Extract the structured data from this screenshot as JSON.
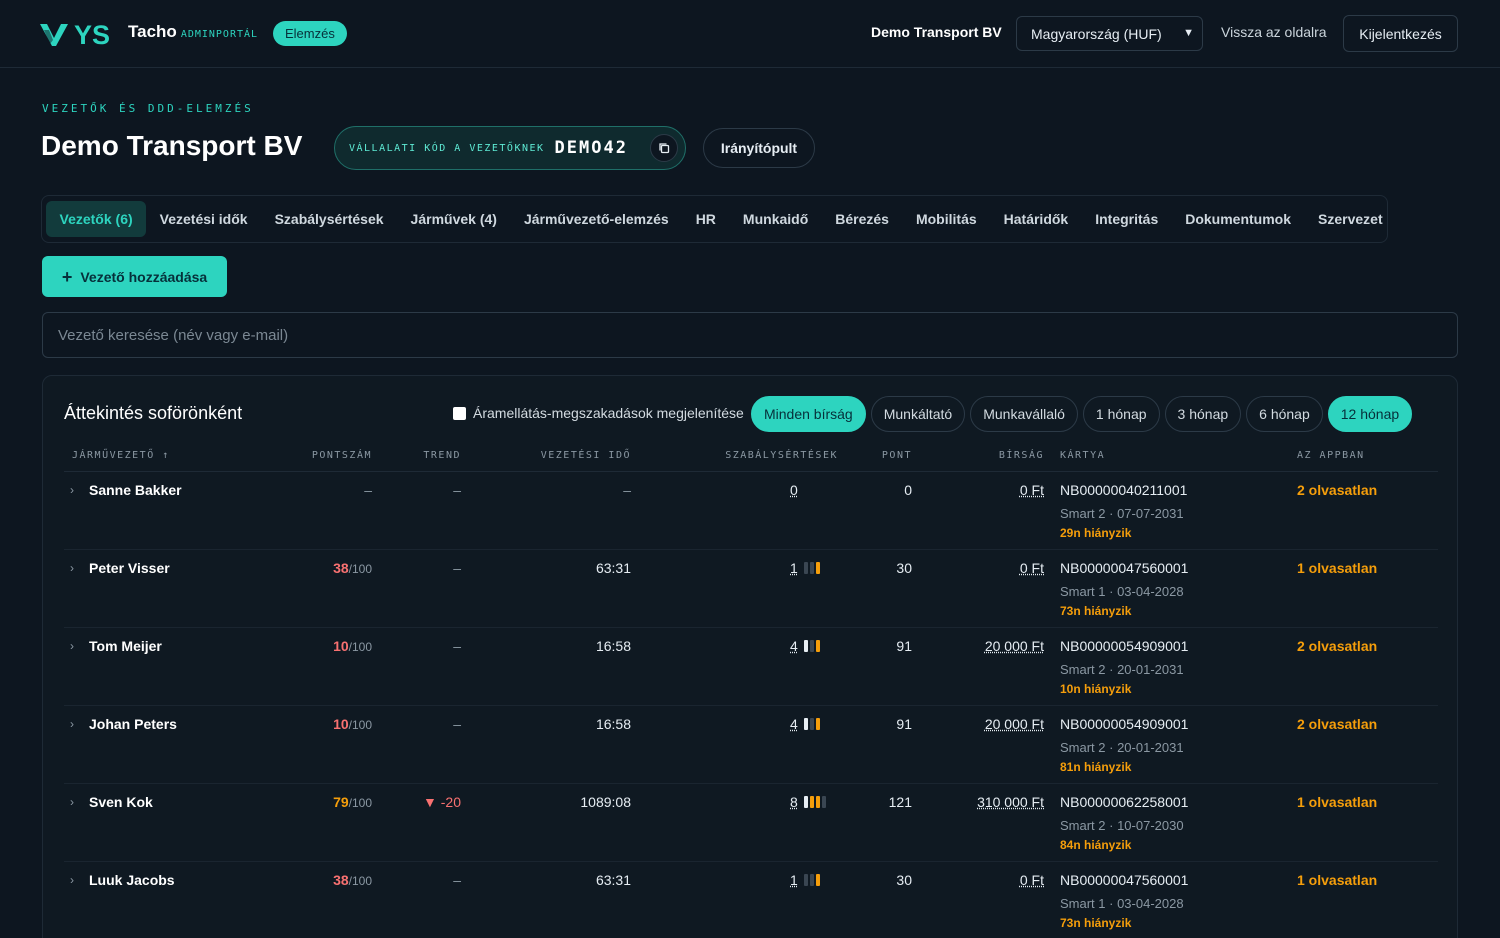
{
  "header": {
    "brand": "Tacho",
    "brand_sub": "ADMINPORTÁL",
    "badge": "Elemzés",
    "company": "Demo Transport BV",
    "country_select": "Magyarország (HUF)",
    "back_link": "Vissza az oldalra",
    "logout": "Kijelentkezés"
  },
  "page": {
    "eyebrow": "VEZETŐK ÉS DDD-ELEMZÉS",
    "title": "Demo Transport BV",
    "code_label": "VÁLLALATI KÓD A VEZETŐKNEK",
    "code_value": "DEMO42",
    "dashboard_button": "Irányítópult"
  },
  "tabs": [
    {
      "label": "Vezetők (6)",
      "active": true
    },
    {
      "label": "Vezetési idők"
    },
    {
      "label": "Szabálysértések"
    },
    {
      "label": "Járművek (4)"
    },
    {
      "label": "Járművezető-elemzés"
    },
    {
      "label": "HR"
    },
    {
      "label": "Munkaidő"
    },
    {
      "label": "Bérezés"
    },
    {
      "label": "Mobilitás"
    },
    {
      "label": "Határidők"
    },
    {
      "label": "Integritás"
    },
    {
      "label": "Dokumentumok"
    },
    {
      "label": "Szervezet"
    }
  ],
  "add_driver_button": "Vezető hozzáadása",
  "search_placeholder": "Vezető keresése (név vagy e-mail)",
  "overview": {
    "title": "Áttekintés soförönként",
    "checkbox_label": "Áramellátás-megszakadások megjelenítése",
    "filters": [
      {
        "label": "Minden bírság",
        "active": true
      },
      {
        "label": "Munkáltató"
      },
      {
        "label": "Munkavállaló"
      },
      {
        "label": "1 hónap"
      },
      {
        "label": "3 hónap"
      },
      {
        "label": "6 hónap"
      },
      {
        "label": "12 hónap",
        "active": true
      }
    ],
    "columns": {
      "driver": "JÁRMŰVEZETŐ ↑",
      "score": "PONTSZÁM",
      "trend": "TREND",
      "drive_time": "VEZETÉSI IDŐ",
      "violations": "SZABÁLYSÉRTÉSEK",
      "points": "PONT",
      "fine": "BÍRSÁG",
      "card": "KÁRTYA",
      "in_app": "AZ APPBAN"
    },
    "rows": [
      {
        "name": "Sanne Bakker",
        "score": "–",
        "score_den": "",
        "trend": "–",
        "drive": "–",
        "violations": "0",
        "bars": [],
        "points": "0",
        "fine": "0 Ft",
        "card_no": "NB00000040211001",
        "card_sub": "Smart 2 · 07-07-2031",
        "card_missing": "29n hiányzik",
        "unread": "2 olvasatlan"
      },
      {
        "name": "Peter Visser",
        "score": "38",
        "score_den": "/100",
        "trend": "–",
        "drive": "63:31",
        "violations": "1",
        "bars": [
          "#3a4652",
          "#3a4652",
          "#f59e0b"
        ],
        "points": "30",
        "fine": "0 Ft",
        "card_no": "NB00000047560001",
        "card_sub": "Smart 1 · 03-04-2028",
        "card_missing": "73n hiányzik",
        "unread": "1 olvasatlan"
      },
      {
        "name": "Tom Meijer",
        "score": "10",
        "score_den": "/100",
        "trend": "–",
        "drive": "16:58",
        "violations": "4",
        "bars": [
          "#e6edf3",
          "#3a4652",
          "#f59e0b"
        ],
        "points": "91",
        "fine": "20 000 Ft",
        "card_no": "NB00000054909001",
        "card_sub": "Smart 2 · 20-01-2031",
        "card_missing": "10n hiányzik",
        "unread": "2 olvasatlan"
      },
      {
        "name": "Johan Peters",
        "score": "10",
        "score_den": "/100",
        "trend": "–",
        "drive": "16:58",
        "violations": "4",
        "bars": [
          "#e6edf3",
          "#3a4652",
          "#f59e0b"
        ],
        "points": "91",
        "fine": "20 000 Ft",
        "card_no": "NB00000054909001",
        "card_sub": "Smart 2 · 20-01-2031",
        "card_missing": "81n hiányzik",
        "unread": "2 olvasatlan"
      },
      {
        "name": "Sven Kok",
        "score": "79",
        "score_den": "/100",
        "trend": "▼ -20",
        "drive": "1089:08",
        "violations": "8",
        "bars": [
          "#e6edf3",
          "#f59e0b",
          "#f59e0b",
          "#3a4652"
        ],
        "points": "121",
        "fine": "310 000 Ft",
        "card_no": "NB00000062258001",
        "card_sub": "Smart 2 · 10-07-2030",
        "card_missing": "84n hiányzik",
        "unread": "1 olvasatlan"
      },
      {
        "name": "Luuk Jacobs",
        "score": "38",
        "score_den": "/100",
        "trend": "–",
        "drive": "63:31",
        "violations": "1",
        "bars": [
          "#3a4652",
          "#3a4652",
          "#f59e0b"
        ],
        "points": "30",
        "fine": "0 Ft",
        "card_no": "NB00000047560001",
        "card_sub": "Smart 1 · 03-04-2028",
        "card_missing": "73n hiányzik",
        "unread": "1 olvasatlan"
      }
    ]
  },
  "colors": {
    "accent": "#2dd4bf",
    "bg": "#0d1620",
    "danger": "#f87171",
    "warning": "#f59e0b"
  }
}
